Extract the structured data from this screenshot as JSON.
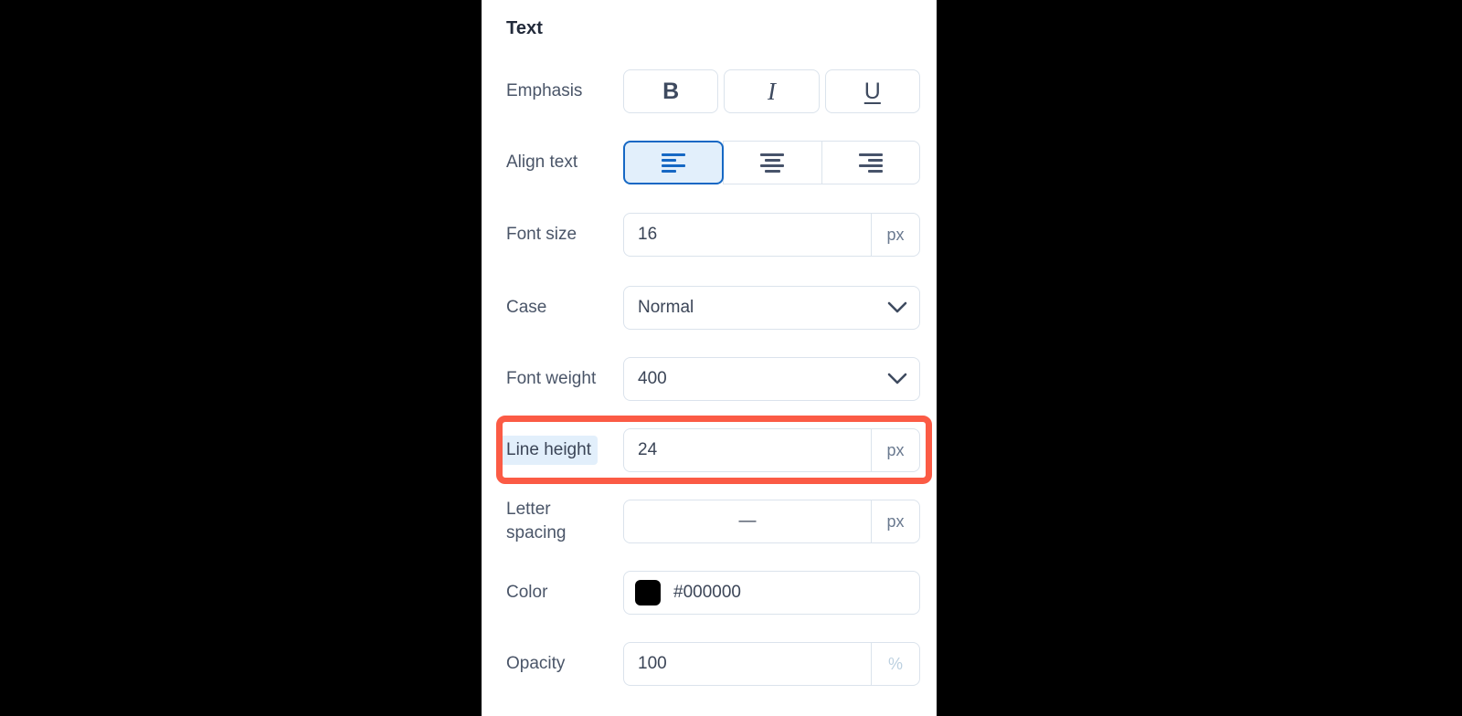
{
  "panel": {
    "section_title": "Text",
    "rows": [
      {
        "id": "emphasis",
        "label": "Emphasis",
        "type": "toggle-group",
        "buttons": [
          {
            "name": "bold-button",
            "glyph": "B",
            "icon": "bold-icon",
            "active": false
          },
          {
            "name": "italic-button",
            "glyph": "I",
            "icon": "italic-icon",
            "active": false
          },
          {
            "name": "underline-button",
            "glyph": "U",
            "icon": "underline-icon",
            "active": false
          }
        ]
      },
      {
        "id": "align-text",
        "label": "Align text",
        "type": "segmented",
        "buttons": [
          {
            "name": "align-left-button",
            "icon": "align-left-icon",
            "active": true
          },
          {
            "name": "align-center-button",
            "icon": "align-center-icon",
            "active": false
          },
          {
            "name": "align-right-button",
            "icon": "align-right-icon",
            "active": false
          }
        ]
      },
      {
        "id": "font-size",
        "label": "Font size",
        "type": "input-suffix",
        "value": "16",
        "suffix": "px",
        "suffix_muted": false
      },
      {
        "id": "case",
        "label": "Case",
        "type": "select",
        "value": "Normal",
        "icon": "chevron-down-icon"
      },
      {
        "id": "font-weight",
        "label": "Font weight",
        "type": "select",
        "value": "400",
        "icon": "chevron-down-icon"
      },
      {
        "id": "line-height",
        "label": "Line height",
        "type": "input-suffix",
        "value": "24",
        "suffix": "px",
        "suffix_muted": false,
        "highlighted": true
      },
      {
        "id": "letter-spacing",
        "label": "Letter spacing",
        "label_line1": "Letter",
        "label_line2": "spacing",
        "type": "input-suffix",
        "value": "—",
        "value_centered": true,
        "suffix": "px",
        "suffix_muted": false
      },
      {
        "id": "color",
        "label": "Color",
        "type": "color",
        "swatch_color": "#000000",
        "value": "#000000"
      },
      {
        "id": "opacity",
        "label": "Opacity",
        "type": "input-suffix",
        "value": "100",
        "suffix": "%",
        "suffix_muted": true
      }
    ]
  },
  "annotation": {
    "highlight_target": "Line height",
    "highlight_color": "#fb5b45",
    "label_highlight_color": "#e2effb"
  },
  "theme": {
    "panel_background": "#ffffff",
    "page_background": "#000000",
    "accent": "#1668c4",
    "border": "#dbe3ec",
    "label_text": "#4a5568",
    "value_text": "#3b4557",
    "title_text": "#232b3b"
  }
}
